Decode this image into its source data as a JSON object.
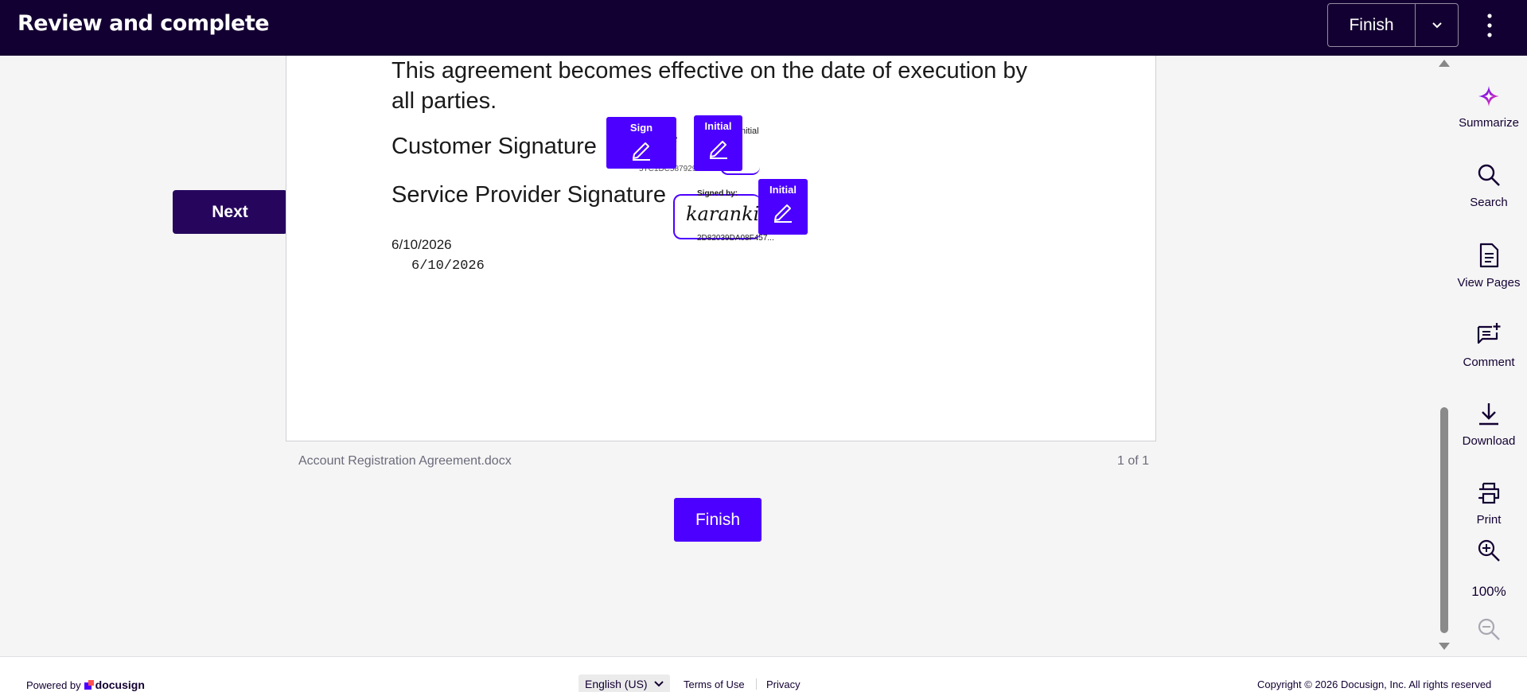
{
  "header": {
    "title": "Review and complete",
    "finish_label": "Finish"
  },
  "navigation": {
    "next_label": "Next"
  },
  "document": {
    "paragraph": "This agreement becomes effective on the date of execution by all parties.",
    "customer_signature_label": "Customer Signature",
    "provider_signature_label": "Service Provider Signature",
    "date_1": "6/10/2026",
    "date_2": "6/10/2026",
    "customer_sig_partial_header": "y:",
    "customer_sig_partial_script": "li",
    "customer_sig_partial_id": "5TC1DC587929",
    "customer_initial_partial": "nitial",
    "provider_signed_by": "Signed by:",
    "provider_signature_script": "karankish",
    "provider_signature_id": "2D82039DA08F457...",
    "file_name": "Account Registration Agreement.docx",
    "page_count": "1 of 1"
  },
  "tags": {
    "sign_label": "Sign",
    "initial_label": "Initial",
    "initial_label_2": "Initial"
  },
  "actions": {
    "finish_bottom_label": "Finish"
  },
  "tools": {
    "summarize": "Summarize",
    "search": "Search",
    "view_pages": "View Pages",
    "comment": "Comment",
    "download": "Download",
    "print": "Print",
    "zoom_level": "100%"
  },
  "footer": {
    "powered_by": "Powered by",
    "brand": "docusign",
    "language": "English (US)",
    "terms": "Terms of Use",
    "privacy": "Privacy",
    "copyright": "Copyright © 2026 Docusign, Inc. All rights reserved"
  },
  "colors": {
    "header_bg": "#130032",
    "accent": "#4c00ff",
    "next_bg": "#26065d"
  },
  "icons": [
    "chevron-down-icon",
    "more-vertical-icon",
    "sparkle-icon",
    "search-icon",
    "document-icon",
    "comment-add-icon",
    "download-icon",
    "print-icon",
    "zoom-in-icon",
    "zoom-out-icon",
    "pen-icon"
  ]
}
